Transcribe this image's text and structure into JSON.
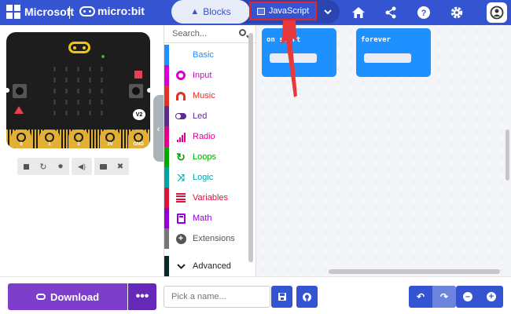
{
  "topbar": {
    "brand": "Microsoft",
    "product": "micro:bit",
    "tabs": {
      "blocks": "Blocks",
      "javascript": "JavaScript"
    },
    "icons": [
      "home-icon",
      "share-icon",
      "help-icon",
      "gear-icon",
      "user-icon"
    ]
  },
  "simulator": {
    "board_version": "V2",
    "pins": [
      "0",
      "1",
      "2",
      "3V",
      "GND"
    ],
    "controls": [
      "stop-icon",
      "restart-icon",
      "debug-icon",
      "sound-icon",
      "screenshot-icon",
      "fullscreen-icon"
    ]
  },
  "toolbox": {
    "search_placeholder": "Search...",
    "categories": [
      {
        "label": "Basic",
        "color": "#1e90ff"
      },
      {
        "label": "Input",
        "color": "#d400d4"
      },
      {
        "label": "Music",
        "color": "#e63022"
      },
      {
        "label": "Led",
        "color": "#5c2d91"
      },
      {
        "label": "Radio",
        "color": "#e3008c"
      },
      {
        "label": "Loops",
        "color": "#00aa00"
      },
      {
        "label": "Logic",
        "color": "#00a4a6"
      },
      {
        "label": "Variables",
        "color": "#dc143c"
      },
      {
        "label": "Math",
        "color": "#9400d3"
      },
      {
        "label": "Extensions",
        "color": "#777777"
      }
    ],
    "advanced_label": "Advanced"
  },
  "workspace": {
    "blocks": [
      {
        "label": "on start",
        "color": "#1e90ff"
      },
      {
        "label": "forever",
        "color": "#1e90ff"
      }
    ]
  },
  "bottombar": {
    "download_label": "Download",
    "more_label": "•••",
    "project_placeholder": "Pick a name...",
    "project_value": ""
  }
}
